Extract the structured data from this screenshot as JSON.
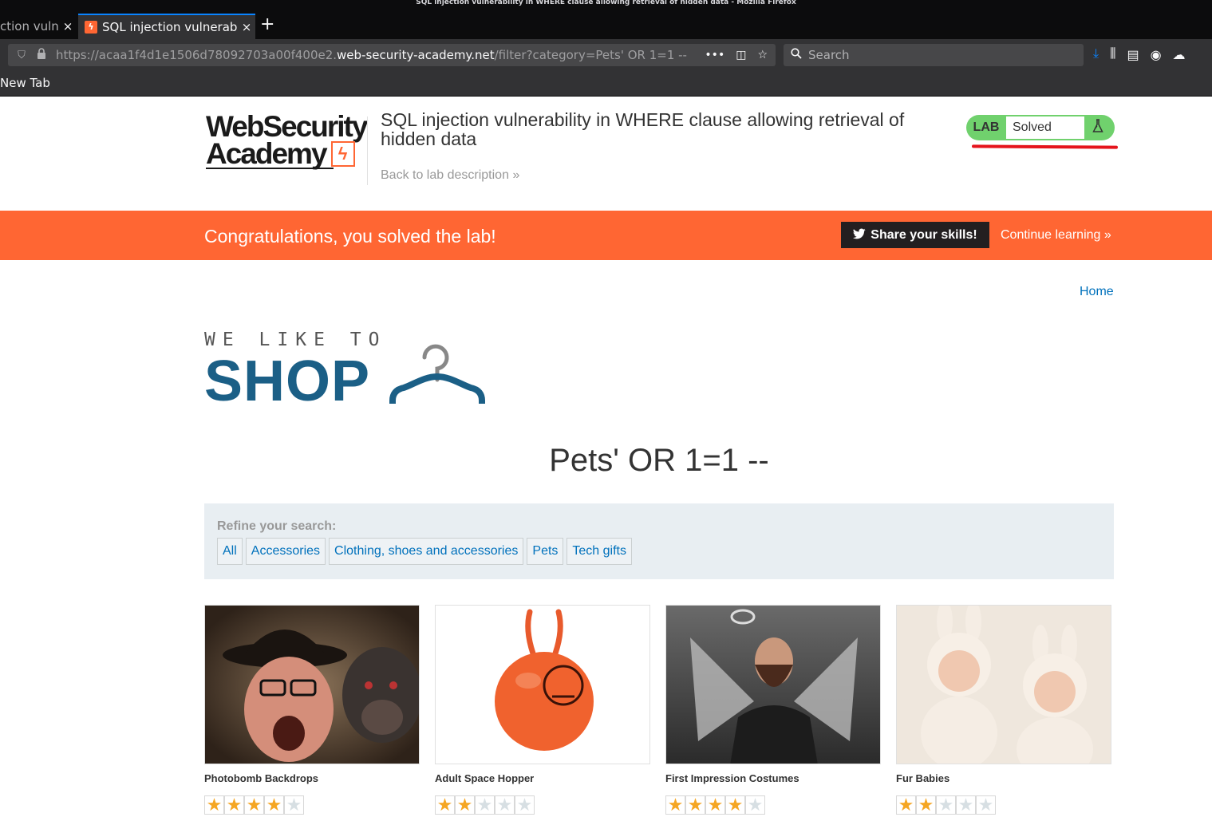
{
  "window": {
    "title": "SQL injection vulnerability in WHERE clause allowing retrieval of hidden data - Mozilla Firefox"
  },
  "tabs": [
    {
      "label": "ction vuln",
      "active": false
    },
    {
      "label": "SQL injection vulnerabi",
      "active": true
    }
  ],
  "icons": {
    "close": "×",
    "new_tab": "+",
    "shield": "⛉",
    "lock": "🔒",
    "more": "•••",
    "pocket": "◫",
    "bookmark_star": "☆",
    "search": "⚲",
    "download": "⤓",
    "library": "⫼",
    "sidebar": "▤",
    "account": "◉",
    "extension": "☁",
    "twitter": "🐦",
    "chevrons": "»",
    "flask": "⚗"
  },
  "urlbar": {
    "prefix": "https://acaa1f4d1e1506d78092703a00f400e2.",
    "domain": "web-security-academy.net",
    "path": "/filter?category=Pets' OR 1=1 --"
  },
  "searchbar": {
    "placeholder": "Search"
  },
  "bookmarks": [
    {
      "label": "New Tab"
    }
  ],
  "academy": {
    "logo_line1": "WebSecurity",
    "logo_line2": "Academy",
    "lab_title": "SQL injection vulnerability in WHERE clause allowing retrieval of hidden data",
    "back_link": "Back to lab description",
    "lab_badge": "LAB",
    "lab_state": "Solved"
  },
  "notification": {
    "message": "Congratulations, you solved the lab!",
    "share_label": "Share your skills!",
    "continue_label": "Continue learning"
  },
  "nav": {
    "home": "Home"
  },
  "shop_logo": {
    "line1": "WE LIKE TO",
    "line2": "SHOP"
  },
  "category_heading": "Pets' OR 1=1 --",
  "filter": {
    "refine_label": "Refine your search:",
    "options": [
      "All",
      "Accessories",
      "Clothing, shoes and accessories",
      "Pets",
      "Tech gifts"
    ]
  },
  "products": [
    {
      "name": "Photobomb Backdrops",
      "rating": 4
    },
    {
      "name": "Adult Space Hopper",
      "rating": 2
    },
    {
      "name": "First Impression Costumes",
      "rating": 4
    },
    {
      "name": "Fur Babies",
      "rating": 2
    }
  ],
  "colors": {
    "accent_orange": "#ff6633",
    "lab_green": "#70d16d",
    "link_blue": "#0071bc",
    "shop_blue": "#1b5f86",
    "star_gold": "#f5a623",
    "annotation_red": "#e5141c"
  }
}
